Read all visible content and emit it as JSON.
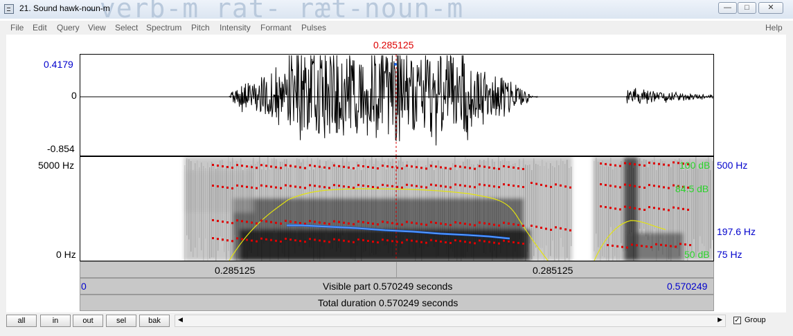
{
  "window": {
    "title": "21. Sound hawk-noun-m",
    "background_text": "-verb-m  rat- ræt-noun-m"
  },
  "menu": [
    "File",
    "Edit",
    "Query",
    "View",
    "Select",
    "Spectrum",
    "Pitch",
    "Intensity",
    "Formant",
    "Pulses"
  ],
  "help": "Help",
  "cursor": "0.285125",
  "waveform": {
    "max": "0.4179",
    "zero": "0",
    "min": "-0.854"
  },
  "spectrogram": {
    "freq_top": "5000 Hz",
    "freq_bottom": "0 Hz",
    "db_top": "100 dB",
    "db_mid": "84.5 dB",
    "db_bottom": "50 dB",
    "pitch_top": "500 Hz",
    "pitch_value": "197.6 Hz",
    "pitch_bottom": "75 Hz"
  },
  "bars": {
    "left_time": "0.285125",
    "right_time": "0.285125",
    "start": "0",
    "visible": "Visible part 0.570249 seconds",
    "end": "0.570249",
    "total": "Total duration 0.570249 seconds"
  },
  "buttons": [
    "all",
    "in",
    "out",
    "sel",
    "bak"
  ],
  "group_label": "Group",
  "colors": {
    "blue": "#0000cc",
    "red": "#dd0000",
    "green": "#2bd42b",
    "pitch": "#1763e8",
    "intensity": "#e3e30f"
  }
}
